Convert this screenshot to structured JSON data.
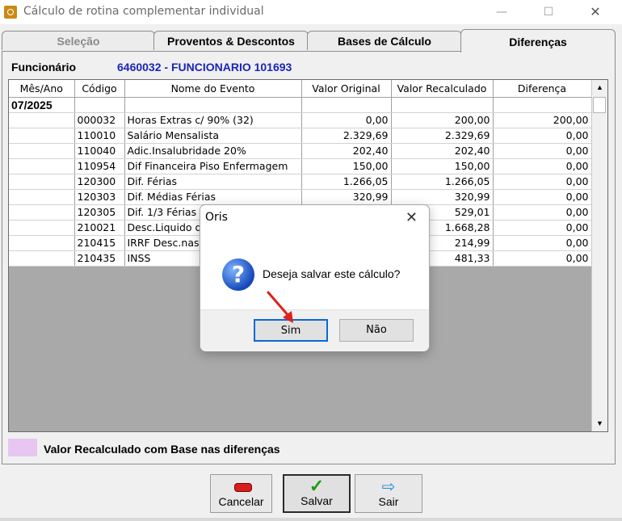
{
  "window": {
    "title": "Cálculo de rotina complementar individual",
    "controls": {
      "minimize": "—",
      "maximize": "☐",
      "close": "✕"
    }
  },
  "tabs": [
    {
      "label": "Seleção",
      "active": false
    },
    {
      "label": "Proventos & Descontos",
      "active": false
    },
    {
      "label": "Bases de Cálculo",
      "active": false
    },
    {
      "label": "Diferenças",
      "active": true
    }
  ],
  "employee": {
    "label": "Funcionário",
    "value": "6460032 - FUNCIONARIO 101693"
  },
  "table": {
    "columns": [
      "Mês/Ano",
      "Código",
      "Nome do Evento",
      "Valor Original",
      "Valor Recalculado",
      "Diferença"
    ],
    "month": "07/2025",
    "rows": [
      {
        "code": "000032",
        "name": "Horas Extras c/ 90% (32)",
        "original": "0,00",
        "recalc": "200,00",
        "diff": "200,00"
      },
      {
        "code": "110010",
        "name": "Salário Mensalista",
        "original": "2.329,69",
        "recalc": "2.329,69",
        "diff": "0,00"
      },
      {
        "code": "110040",
        "name": "Adic.Insalubridade 20%",
        "original": "202,40",
        "recalc": "202,40",
        "diff": "0,00"
      },
      {
        "code": "110954",
        "name": "Dif Financeira Piso Enfermagem",
        "original": "150,00",
        "recalc": "150,00",
        "diff": "0,00"
      },
      {
        "code": "120300",
        "name": "Dif. Férias",
        "original": "1.266,05",
        "recalc": "1.266,05",
        "diff": "0,00"
      },
      {
        "code": "120303",
        "name": "Dif. Médias Férias",
        "original": "320,99",
        "recalc": "320,99",
        "diff": "0,00"
      },
      {
        "code": "120305",
        "name": "Dif. 1/3 Férias",
        "original": "",
        "recalc": "529,01",
        "diff": "0,00"
      },
      {
        "code": "210021",
        "name": "Desc.Liquido d",
        "original": "",
        "recalc": "1.668,28",
        "diff": "0,00"
      },
      {
        "code": "210415",
        "name": "IRRF Desc.nas",
        "original": "",
        "recalc": "214,99",
        "diff": "0,00"
      },
      {
        "code": "210435",
        "name": "INSS",
        "original": "",
        "recalc": "481,33",
        "diff": "0,00"
      }
    ]
  },
  "legend": {
    "text": "Valor Recalculado com Base nas diferenças",
    "color": "#e7c6f1"
  },
  "buttons": {
    "cancel": "Cancelar",
    "save": "Salvar",
    "exit": "Sair"
  },
  "dialog": {
    "title": "Oris",
    "close": "✕",
    "icon": "?",
    "message": "Deseja salvar este cálculo?",
    "yes": "Sim",
    "no": "Não"
  },
  "colors": {
    "employee_value": "#1a25b8",
    "arrow": "#e0201c",
    "dialog_default_border": "#0a68d6"
  }
}
